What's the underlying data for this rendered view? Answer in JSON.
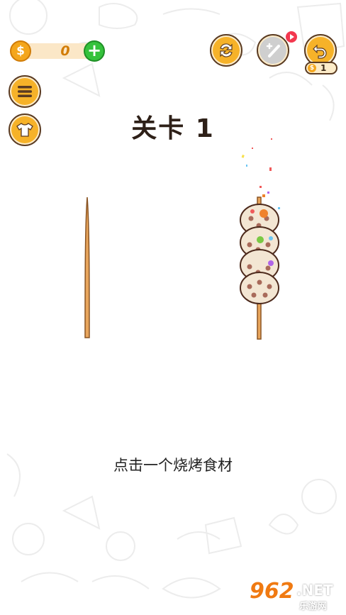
{
  "hud": {
    "coin_symbol": "$",
    "coin_count": "0",
    "add_symbol": "+",
    "undo_cost": "1"
  },
  "level": {
    "title": "关卡 1"
  },
  "instruction": "点击一个烧烤食材",
  "watermark": {
    "main": "962",
    "net": ".NET",
    "sub": "乐游网"
  },
  "colors": {
    "coin": "#f4a61c",
    "add": "#35c23c",
    "button_fill": "#f6b229",
    "badge": "#f3384f"
  },
  "icons": [
    "refresh-icon",
    "magic-wand-icon",
    "video-badge-icon",
    "undo-icon",
    "menu-icon",
    "shirt-icon"
  ]
}
